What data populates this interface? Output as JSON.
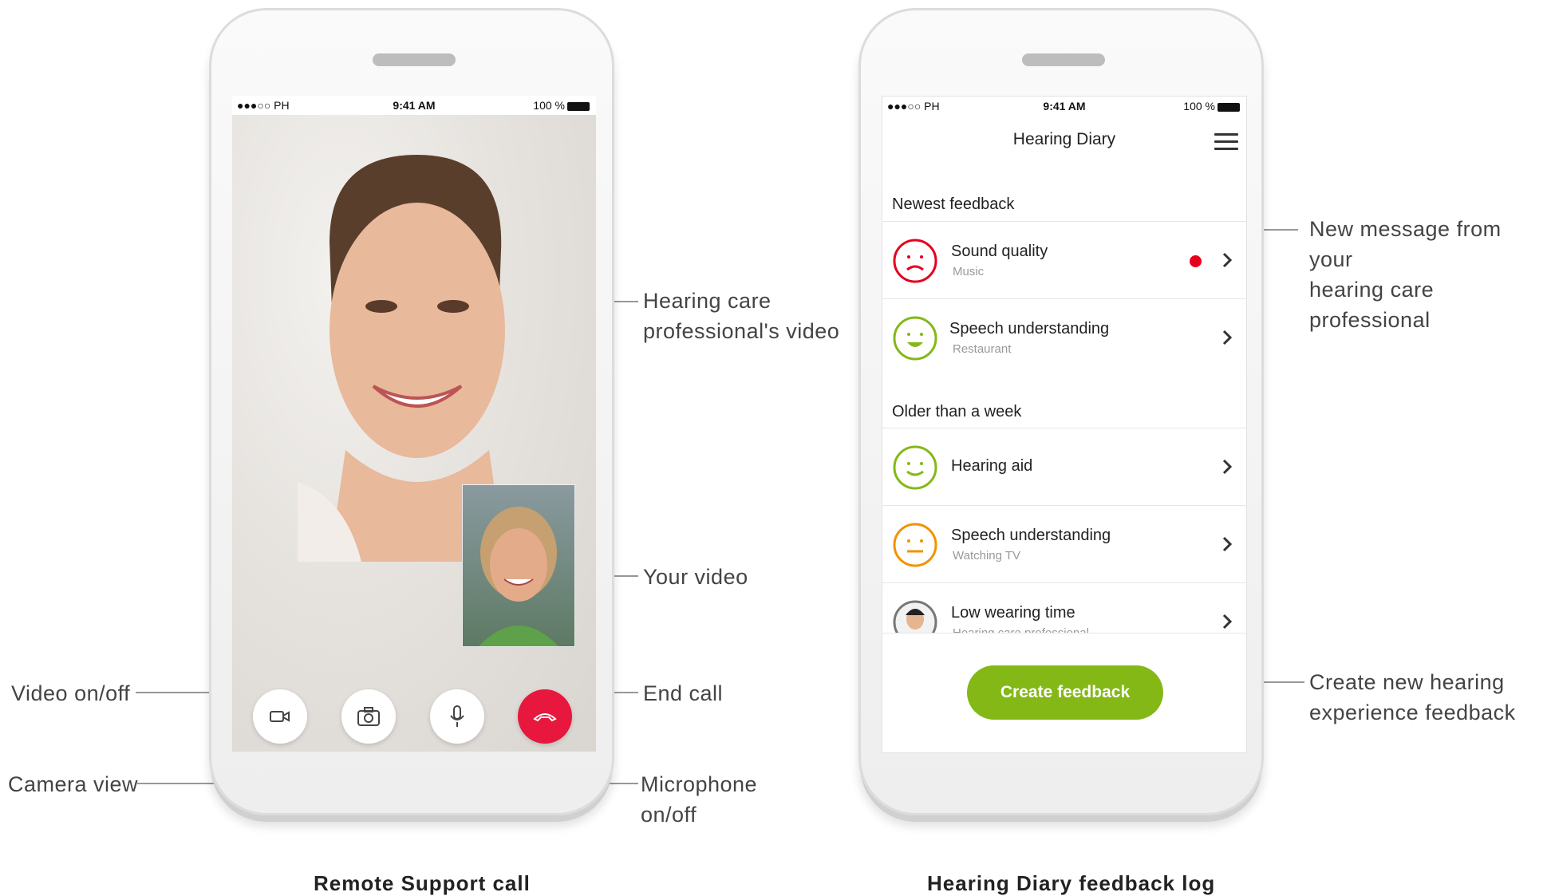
{
  "status_bar": {
    "carrier": "●●●○○ PH",
    "time": "9:41 AM",
    "battery": "100 %"
  },
  "left_phone": {
    "caption": "Remote Support call",
    "annotations": {
      "hcp_video": [
        "Hearing care",
        "professional's video"
      ],
      "your_video": "Your video",
      "video_toggle": "Video on/off",
      "end_call": "End call",
      "camera_view": "Camera view",
      "microphone": [
        "Microphone",
        "on/off"
      ]
    },
    "controls": [
      {
        "icon": "video-camera-icon"
      },
      {
        "icon": "camera-switch-icon"
      },
      {
        "icon": "microphone-icon"
      },
      {
        "icon": "hang-up-icon"
      }
    ]
  },
  "right_phone": {
    "caption": "Hearing Diary feedback log",
    "header_title": "Hearing Diary",
    "sections": {
      "newest": "Newest feedback",
      "older": "Older than a week"
    },
    "items": [
      {
        "title": "Sound quality",
        "subtitle": "Music",
        "mood": "sad",
        "color": "#e5001e",
        "new_message": true
      },
      {
        "title": "Speech understanding",
        "subtitle": "Restaurant",
        "mood": "happy",
        "color": "#84b817"
      },
      {
        "title": "Hearing aid",
        "subtitle": "",
        "mood": "smile",
        "color": "#84b817"
      },
      {
        "title": "Speech understanding",
        "subtitle": "Watching TV",
        "mood": "neutral",
        "color": "#f39200"
      },
      {
        "title": "Low wearing time",
        "subtitle": "Hearing care professional",
        "mood": "avatar"
      }
    ],
    "create_button": "Create feedback",
    "annotations": {
      "new_message": [
        "New message from your",
        "hearing care professional"
      ],
      "create_new": [
        "Create new hearing",
        "experience feedback"
      ]
    }
  }
}
